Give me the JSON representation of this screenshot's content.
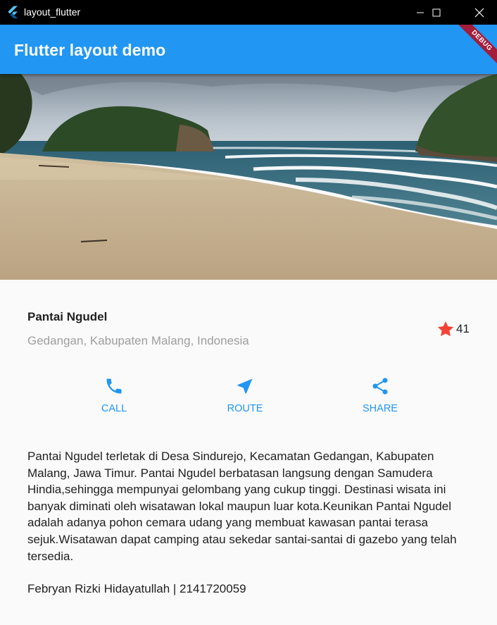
{
  "window": {
    "title": "layout_flutter",
    "minimize_icon": "minimize-icon",
    "maximize_icon": "maximize-icon",
    "close_icon": "close-icon"
  },
  "appbar": {
    "title": "Flutter layout demo",
    "color": "#2196f3",
    "debug_banner": "DEBUG"
  },
  "hero": {
    "image": "beach-photo"
  },
  "title_section": {
    "name": "Pantai Ngudel",
    "location": "Gedangan, Kabupaten Malang, Indonesia",
    "star_icon": "star-icon",
    "star_color": "#f44336",
    "rating_count": "41"
  },
  "actions": [
    {
      "label": "CALL",
      "icon": "phone-icon"
    },
    {
      "label": "ROUTE",
      "icon": "navigation-icon"
    },
    {
      "label": "SHARE",
      "icon": "share-icon"
    }
  ],
  "accent_color": "#2196f3",
  "description": "Pantai Ngudel terletak di Desa Sindurejo, Kecamatan Gedangan, Kabupaten Malang, Jawa Timur. Pantai Ngudel berbatasan langsung dengan Samudera Hindia,sehingga mempunyai gelombang yang cukup tinggi. Destinasi wisata ini banyak diminati oleh wisatawan lokal maupun luar kota.Keunikan Pantai Ngudel adalah adanya pohon cemara udang yang membuat kawasan pantai terasa sejuk.Wisatawan dapat camping atau sekedar santai-santai di gazebo yang telah tersedia.",
  "author": "Febryan Rizki Hidayatullah | 2141720059"
}
